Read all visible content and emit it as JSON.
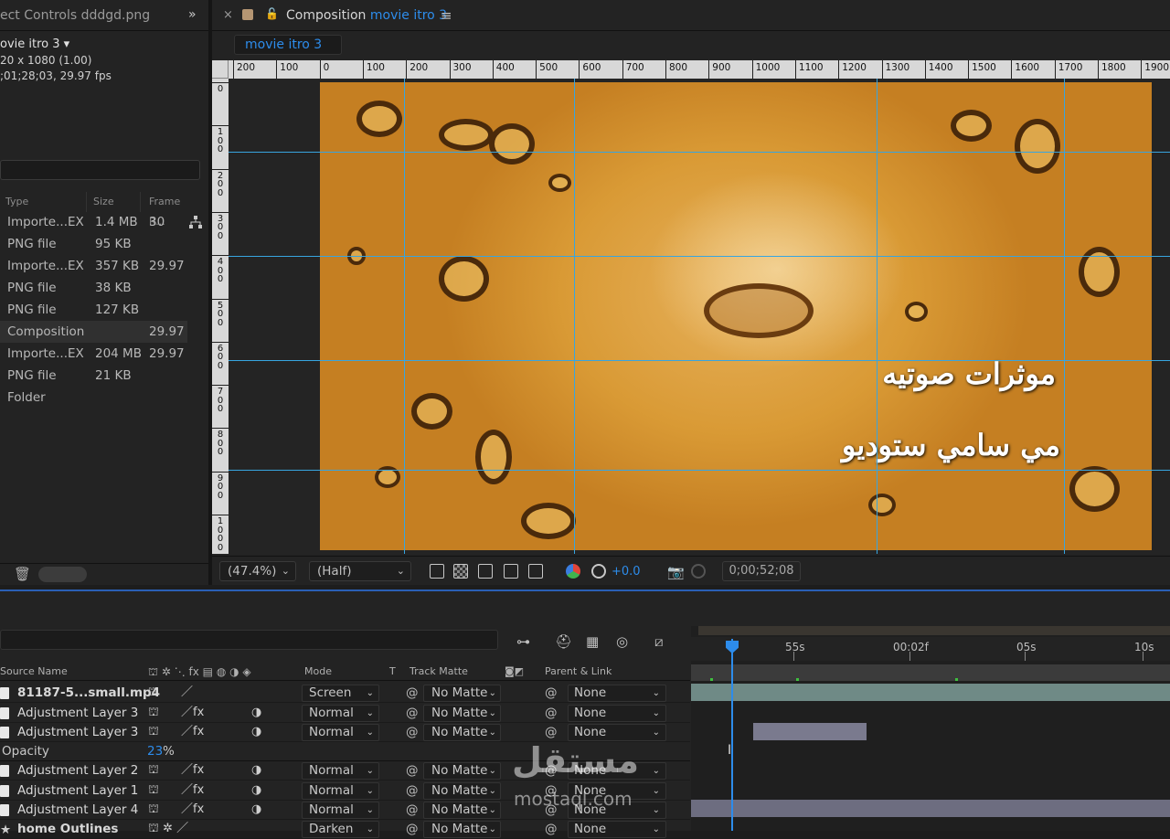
{
  "project": {
    "tab_label": "ect Controls dddgd.png",
    "comp_name": "ovie itro 3 ▾",
    "dimensions": "20 x 1080 (1.00)",
    "duration_fps": ";01;28;03, 29.97 fps",
    "columns": [
      "Type",
      "Size",
      "Frame R..."
    ],
    "rows": [
      {
        "type": "Importe...EX",
        "size": "1.4 MB",
        "fps": "30"
      },
      {
        "type": "PNG file",
        "size": "95 KB",
        "fps": ""
      },
      {
        "type": "Importe...EX",
        "size": "357 KB",
        "fps": "29.97"
      },
      {
        "type": "PNG file",
        "size": "38 KB",
        "fps": ""
      },
      {
        "type": "PNG file",
        "size": "127 KB",
        "fps": ""
      },
      {
        "type": "Composition",
        "size": "",
        "fps": "29.97"
      },
      {
        "type": "Importe...EX",
        "size": "204 MB",
        "fps": "29.97"
      },
      {
        "type": "PNG file",
        "size": "21 KB",
        "fps": ""
      },
      {
        "type": "Folder",
        "size": "",
        "fps": ""
      }
    ]
  },
  "viewer": {
    "tab_prefix": "Composition",
    "comp_name": "movie itro 3",
    "subtab": "movie itro 3",
    "ruler_labels": [
      "200",
      "100",
      "0",
      "100",
      "200",
      "300",
      "400",
      "500",
      "600",
      "700",
      "800",
      "900",
      "1000",
      "1100",
      "1200",
      "1300",
      "1400",
      "1500",
      "1600",
      "1700",
      "1800",
      "1900"
    ],
    "vruler_labels": [
      "0",
      "100",
      "200",
      "300",
      "400",
      "500",
      "600",
      "700",
      "800",
      "900",
      "1000"
    ],
    "overlay_line1": "موثرات صوتيه",
    "overlay_line2": "مي سامي ستوديو",
    "zoom": "(47.4%)",
    "resolution": "(Half)",
    "exposure": "+0.0",
    "timecode": "0;00;52;08",
    "accent_color": "#2d8ceb"
  },
  "timeline": {
    "columns": {
      "source": "Source Name",
      "mode": "Mode",
      "t": "T",
      "matte": "Track Matte",
      "parent": "Parent & Link"
    },
    "time_labels": [
      "55s",
      "00:02f",
      "05s",
      "10s"
    ],
    "layers": [
      {
        "name": "81187-5...small.mp4",
        "mode": "Screen",
        "matte": "No Matte",
        "parent": "None"
      },
      {
        "name": "Adjustment Layer 3",
        "mode": "Normal",
        "matte": "No Matte",
        "parent": "None"
      },
      {
        "name": "Adjustment Layer 3",
        "mode": "Normal",
        "matte": "No Matte",
        "parent": "None"
      },
      {
        "name": "Adjustment Layer 2",
        "mode": "Normal",
        "matte": "No Matte",
        "parent": "None"
      },
      {
        "name": "Adjustment Layer 1",
        "mode": "Normal",
        "matte": "No Matte",
        "parent": "None"
      },
      {
        "name": "Adjustment Layer 4",
        "mode": "Normal",
        "matte": "No Matte",
        "parent": "None"
      },
      {
        "name": "home Outlines",
        "mode": "Darken",
        "matte": "No Matte",
        "parent": "None"
      }
    ],
    "opacity_label": "Opacity",
    "opacity_value": "23",
    "opacity_unit": "%"
  },
  "watermark": {
    "arabic": "مستقل",
    "latin": "mostaql.com"
  }
}
